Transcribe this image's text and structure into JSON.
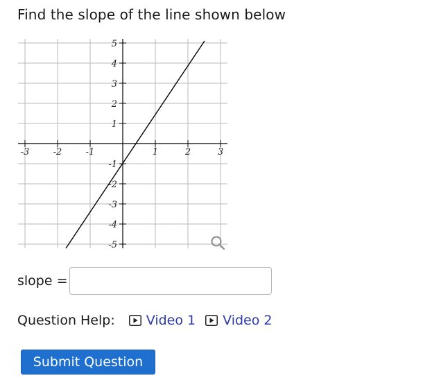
{
  "question": {
    "text": "Find the slope of the line shown below"
  },
  "graph": {
    "x_ticks": [
      "-3",
      "-2",
      "-1",
      "1",
      "2",
      "3"
    ],
    "y_ticks": [
      "5",
      "4",
      "3",
      "2",
      "1",
      "-1",
      "-2",
      "-3",
      "-4",
      "-5"
    ],
    "line_color": "#000000",
    "grid_color": "#b8b8b8",
    "zoom_icon": "magnifier-icon"
  },
  "answer": {
    "label": "slope =",
    "value": "",
    "placeholder": ""
  },
  "help": {
    "label": "Question Help:",
    "videos": [
      {
        "label": "Video 1",
        "icon": "play-icon"
      },
      {
        "label": "Video 2",
        "icon": "play-icon"
      }
    ],
    "link_color": "#2d3aa8"
  },
  "submit": {
    "label": "Submit Question",
    "color": "#1f6fcf"
  }
}
